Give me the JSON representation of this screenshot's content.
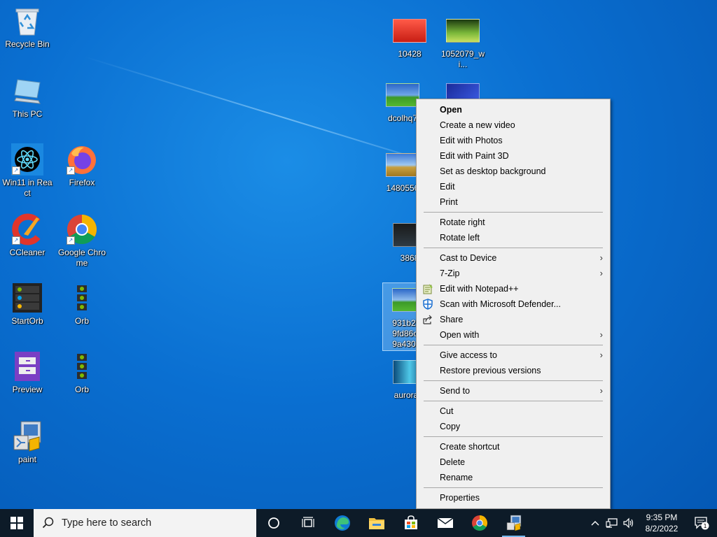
{
  "desktop": {
    "icons": [
      {
        "label": "Recycle Bin"
      },
      {
        "label": "This PC"
      },
      {
        "label": "Win11 in React"
      },
      {
        "label": "Firefox"
      },
      {
        "label": "CCleaner"
      },
      {
        "label": "Google Chrome"
      },
      {
        "label": "StartOrb"
      },
      {
        "label": "Orb"
      },
      {
        "label": "Preview"
      },
      {
        "label": "Orb"
      },
      {
        "label": "paint"
      },
      {
        "label": "10428"
      },
      {
        "label": "1052079_wi..."
      },
      {
        "label": "dcolhq7"
      },
      {
        "label": "1480556"
      },
      {
        "label": "3868"
      },
      {
        "label": "931b295\n9fd86c3\n9a4304bl"
      },
      {
        "label": "aurora-v"
      }
    ]
  },
  "context_menu": {
    "items": [
      {
        "label": "Open"
      },
      {
        "label": "Create a new video"
      },
      {
        "label": "Edit with Photos"
      },
      {
        "label": "Edit with Paint 3D"
      },
      {
        "label": "Set as desktop background"
      },
      {
        "label": "Edit"
      },
      {
        "label": "Print"
      },
      {
        "label": "Rotate right"
      },
      {
        "label": "Rotate left"
      },
      {
        "label": "Cast to Device"
      },
      {
        "label": "7-Zip"
      },
      {
        "label": "Edit with Notepad++"
      },
      {
        "label": "Scan with Microsoft Defender..."
      },
      {
        "label": "Share"
      },
      {
        "label": "Open with"
      },
      {
        "label": "Give access to"
      },
      {
        "label": "Restore previous versions"
      },
      {
        "label": "Send to"
      },
      {
        "label": "Cut"
      },
      {
        "label": "Copy"
      },
      {
        "label": "Create shortcut"
      },
      {
        "label": "Delete"
      },
      {
        "label": "Rename"
      },
      {
        "label": "Properties"
      }
    ],
    "submenu_arrow": "›"
  },
  "taskbar": {
    "search_placeholder": "Type here to search",
    "time": "9:35 PM",
    "date": "8/2/2022",
    "notification_count": "1"
  },
  "colors": {
    "desktop_blue": "#0a6fd1",
    "taskbar_bg": "#0d1b28",
    "menu_bg": "#f0f0f0"
  }
}
